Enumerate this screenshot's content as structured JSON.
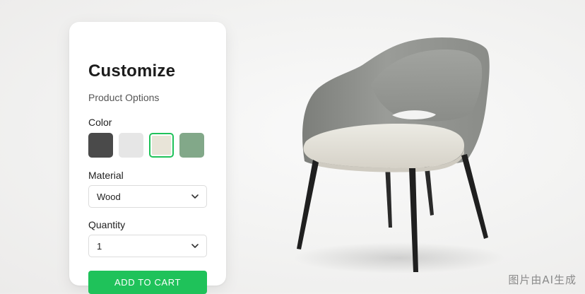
{
  "panel": {
    "title": "Customize",
    "subtitle": "Product Options",
    "color": {
      "label": "Color",
      "swatches": [
        {
          "name": "charcoal",
          "hex": "#4a4a4a"
        },
        {
          "name": "light-gray",
          "hex": "#e6e6e6"
        },
        {
          "name": "beige",
          "hex": "#e8e4d8",
          "selected": true
        },
        {
          "name": "sage-green",
          "hex": "#82a889"
        }
      ]
    },
    "material": {
      "label": "Material",
      "value": "Wood",
      "icon": "chevron-down-icon"
    },
    "quantity": {
      "label": "Quantity",
      "value": "1",
      "icon": "chevron-down-icon"
    },
    "cart_button": "ADD TO CART"
  },
  "product": {
    "image": "armchair-photo",
    "colors": {
      "shell": "#8f918d",
      "seat": "#e7e4dc",
      "legs": "#222222"
    }
  },
  "watermark": "图片由AI生成",
  "colors": {
    "accent": "#1fc25a",
    "background": "#f2f2f1",
    "panel": "#ffffff"
  }
}
